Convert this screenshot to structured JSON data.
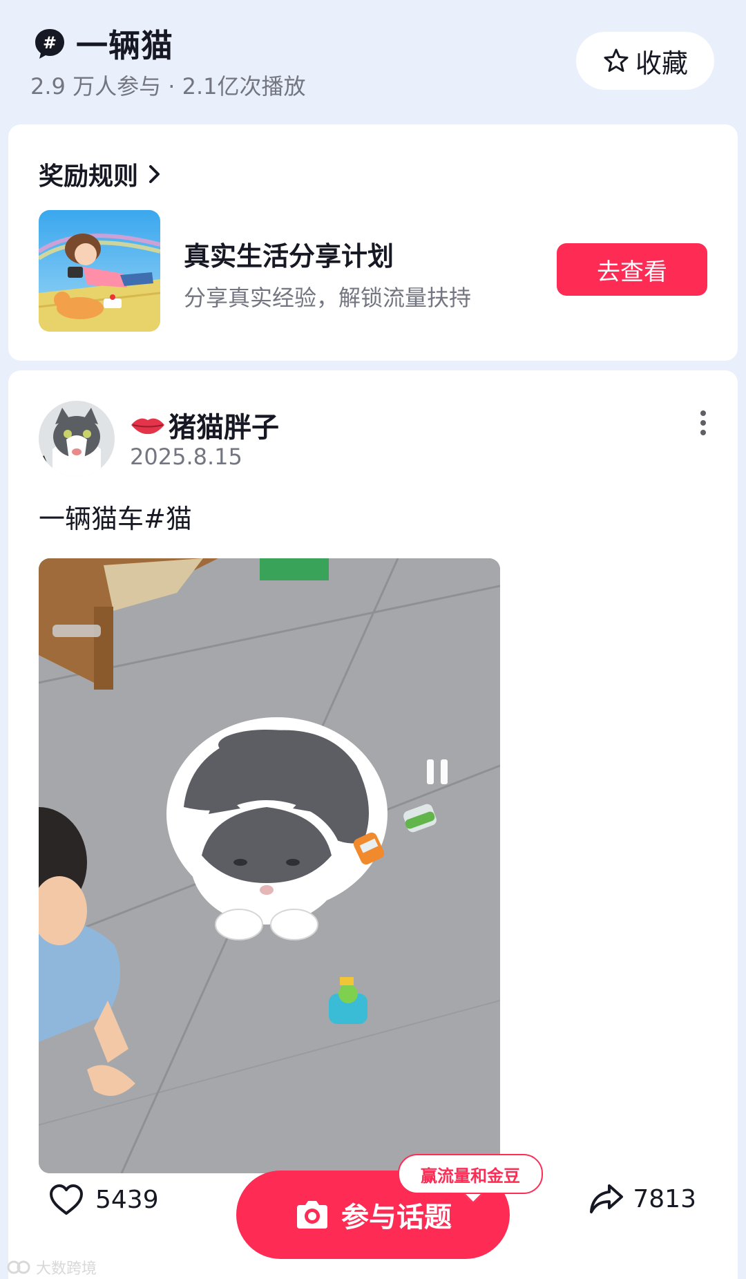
{
  "header": {
    "hashtag_icon": "hashtag-bubble-icon",
    "title": "一辆猫",
    "stats": "2.9 万人参与 · 2.1亿次播放",
    "favorite_icon": "star-outline-icon",
    "favorite_label": "收藏"
  },
  "reward": {
    "rules_label": "奖励规则",
    "plan_title": "真实生活分享计划",
    "plan_subtitle": "分享真实经验，解锁流量扶持",
    "view_button": "去查看"
  },
  "post": {
    "author_badge_icon": "lips-icon",
    "author": "猪猫胖子",
    "date": "2025.8.15",
    "caption": "一辆猫车#猫"
  },
  "footer": {
    "likes": "5439",
    "shares": "7813",
    "join_label": "参与话题",
    "promo_bubble": "赢流量和金豆",
    "watermark": "大数跨境"
  },
  "colors": {
    "accent": "#fe2c55",
    "page_bg": "#eaf0fb",
    "secondary_text": "#737680"
  }
}
